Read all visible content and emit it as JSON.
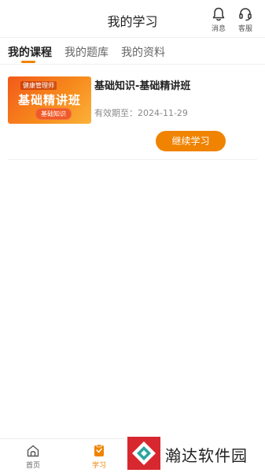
{
  "header": {
    "title": "我的学习",
    "message_label": "消息",
    "service_label": "客服"
  },
  "tabs": [
    {
      "label": "我的课程",
      "active": true
    },
    {
      "label": "我的题库",
      "active": false
    },
    {
      "label": "我的资料",
      "active": false
    }
  ],
  "course": {
    "thumbnail": {
      "top_text": "健康管理师",
      "main_text": "基础精讲班",
      "sub_text": "基础知识"
    },
    "title": "基础知识-基础精讲班",
    "expire_text": "有效期至：2024-11-29",
    "action_label": "继续学习"
  },
  "tabbar": {
    "items": [
      {
        "label": "首页",
        "icon": "home-icon",
        "active": false
      },
      {
        "label": "学习",
        "icon": "study-icon",
        "active": true
      }
    ]
  },
  "watermark": {
    "text": "瀚达软件园"
  },
  "colors": {
    "accent": "#f08300",
    "watermark_red": "#d8282f",
    "watermark_teal": "#2aa5a0"
  }
}
